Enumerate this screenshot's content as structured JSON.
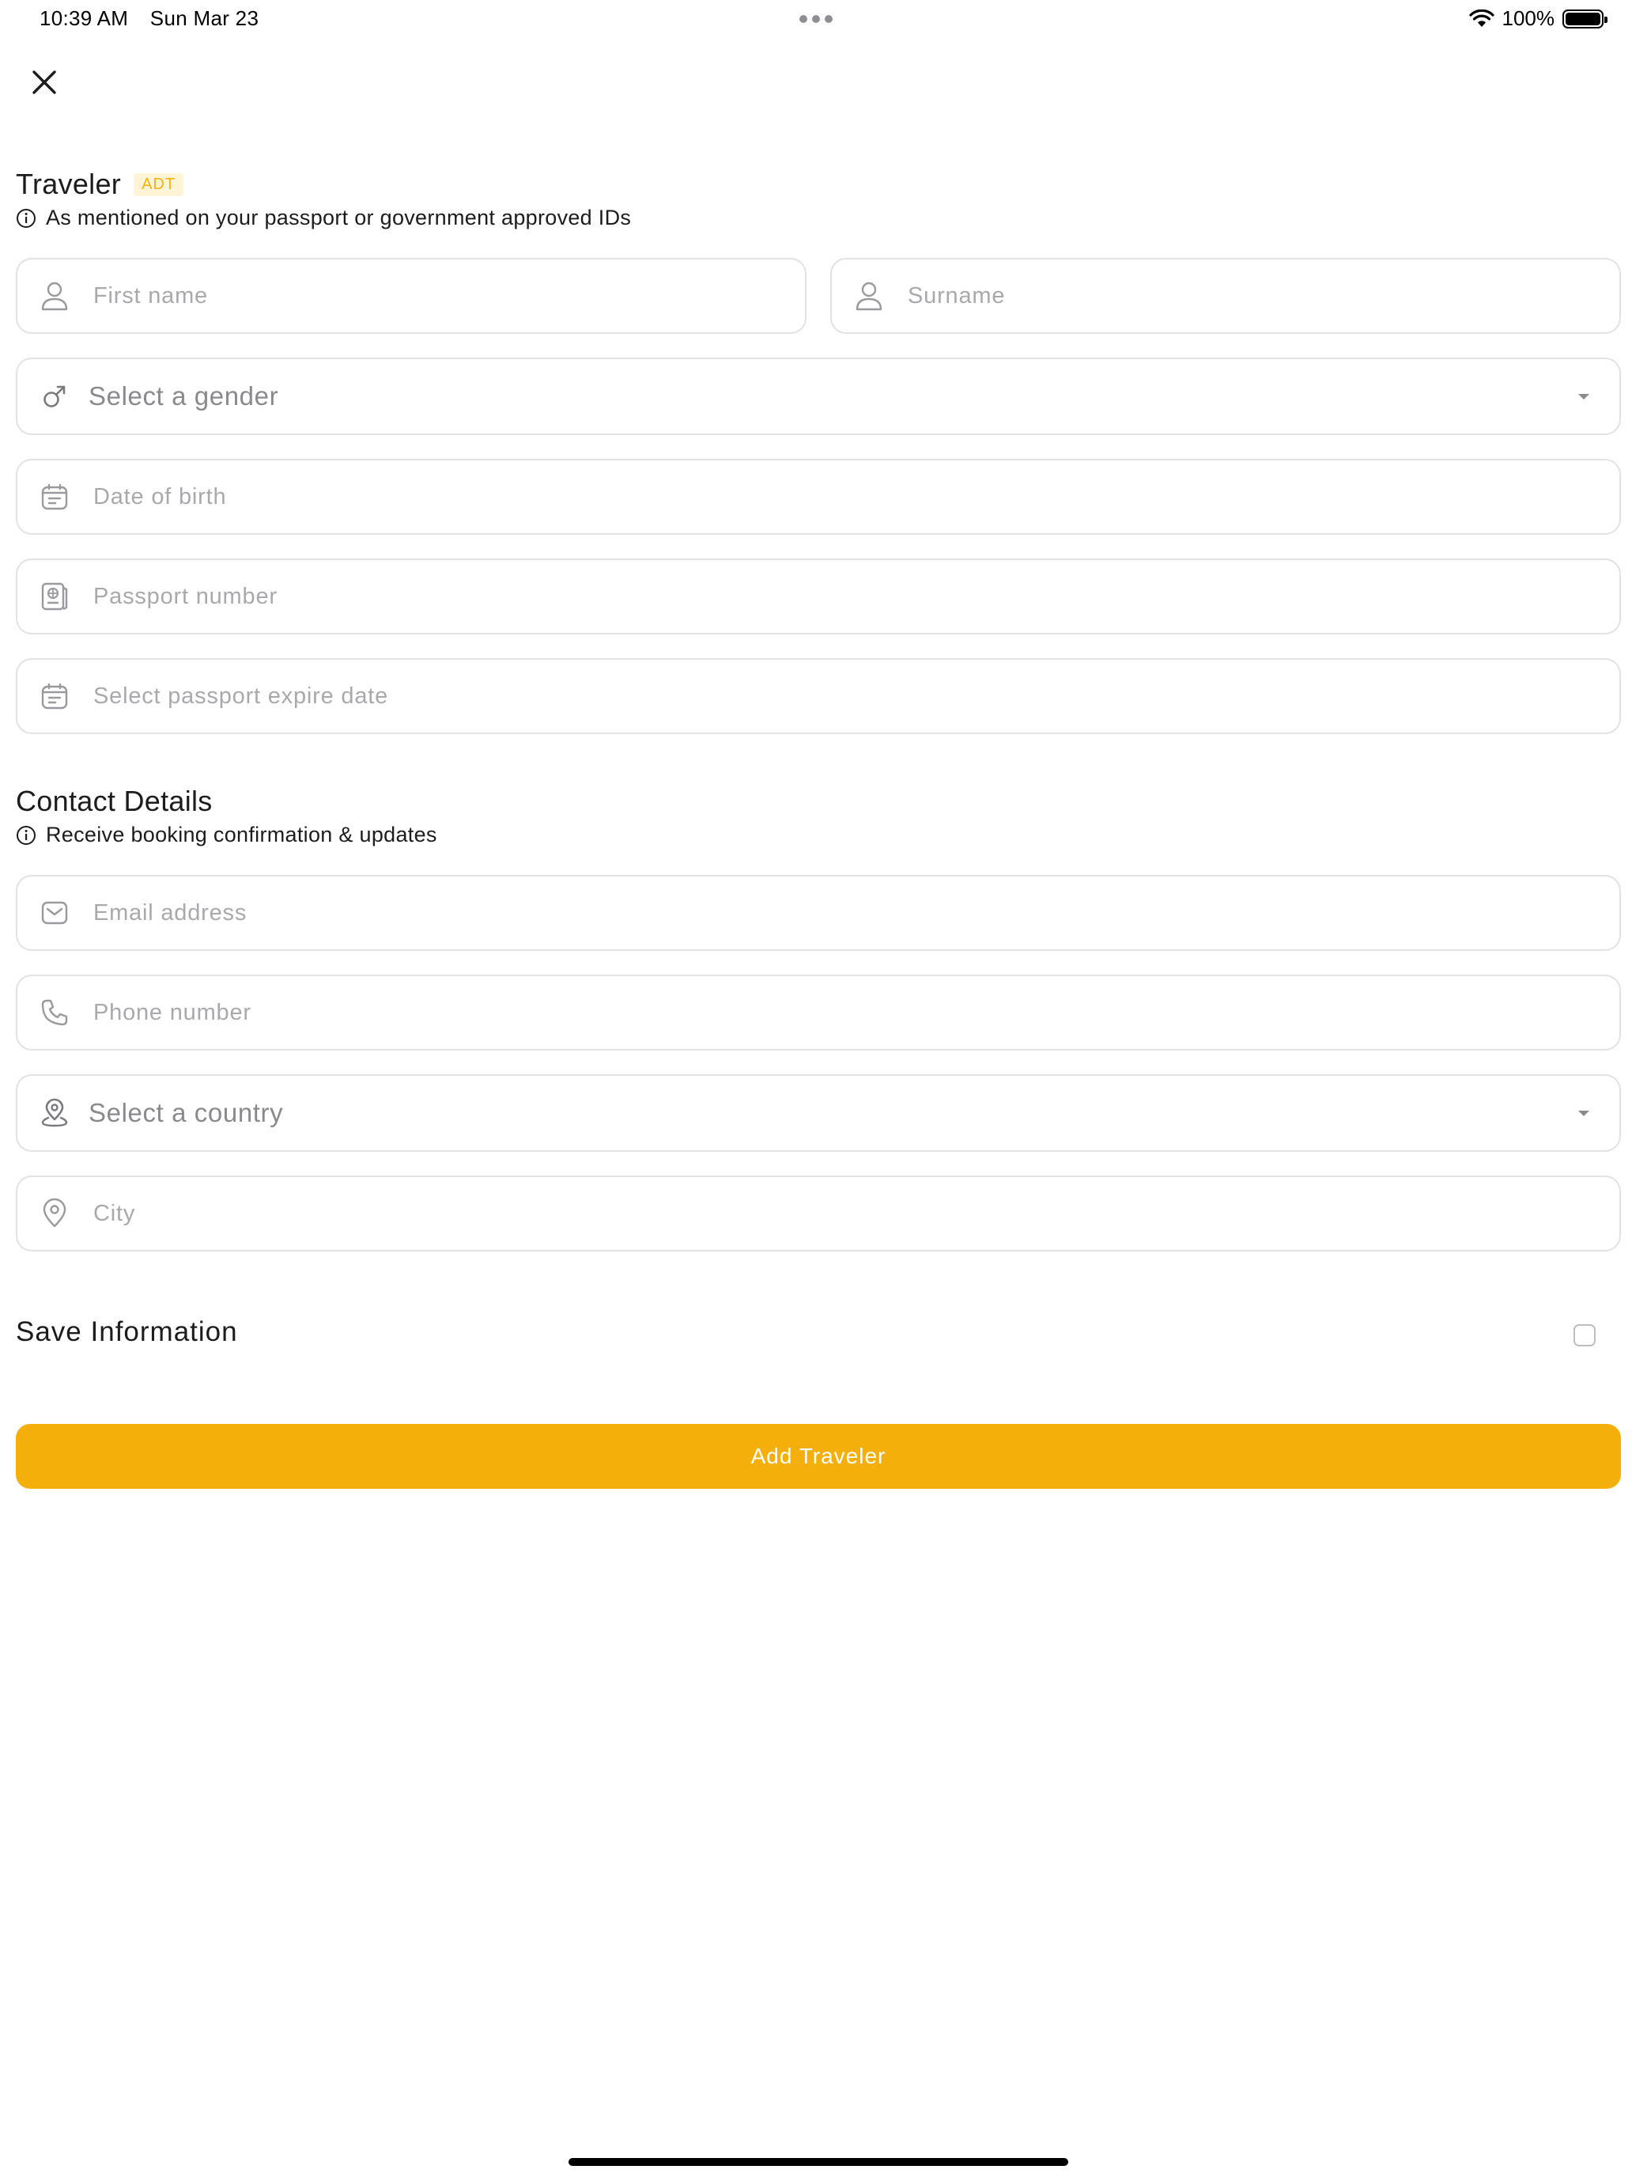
{
  "status_bar": {
    "time": "10:39 AM",
    "date": "Sun Mar 23",
    "battery": "100%"
  },
  "traveler": {
    "title": "Traveler",
    "badge": "ADT",
    "subtitle": "As mentioned on your passport or government approved IDs",
    "first_name_placeholder": "First name",
    "surname_placeholder": "Surname",
    "gender_placeholder": "Select a gender",
    "dob_placeholder": "Date of birth",
    "passport_placeholder": "Passport number",
    "passport_expiry_placeholder": "Select passport expire date"
  },
  "contact": {
    "title": "Contact Details",
    "subtitle": "Receive booking confirmation & updates",
    "email_placeholder": "Email address",
    "phone_placeholder": "Phone number",
    "country_placeholder": "Select a country",
    "city_placeholder": "City"
  },
  "save_info": {
    "label": "Save Information",
    "checked": false
  },
  "actions": {
    "add_label": "Add Traveler"
  },
  "colors": {
    "accent": "#f5af0a",
    "border": "#e2e2e2",
    "placeholder": "#a9a9ad"
  }
}
